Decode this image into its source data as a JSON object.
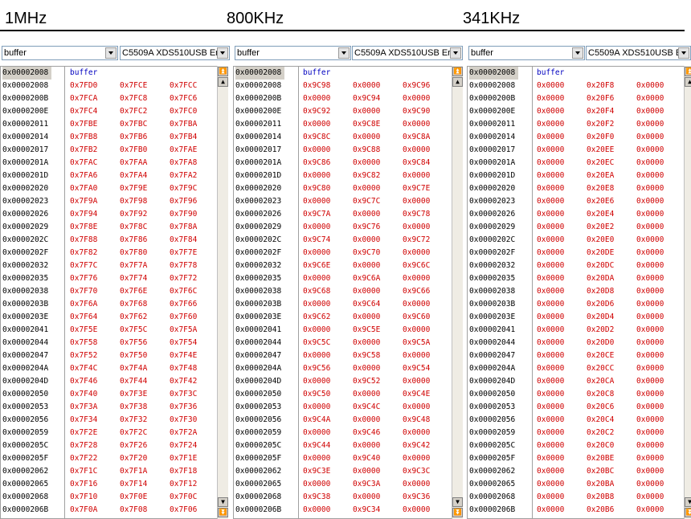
{
  "titles": [
    "1MHz",
    "800KHz",
    "341KHz"
  ],
  "panels": [
    {
      "combo_var": "buffer",
      "combo_target": "C5509A XDS510USB Er",
      "header_label": "buffer",
      "first_addr": "0x00002008",
      "rows": [
        {
          "addr": "0x00002008",
          "v": [
            "0x7FD0",
            "0x7FCE",
            "0x7FCC"
          ]
        },
        {
          "addr": "0x0000200B",
          "v": [
            "0x7FCA",
            "0x7FC8",
            "0x7FC6"
          ]
        },
        {
          "addr": "0x0000200E",
          "v": [
            "0x7FC4",
            "0x7FC2",
            "0x7FC0"
          ]
        },
        {
          "addr": "0x00002011",
          "v": [
            "0x7FBE",
            "0x7FBC",
            "0x7FBA"
          ]
        },
        {
          "addr": "0x00002014",
          "v": [
            "0x7FB8",
            "0x7FB6",
            "0x7FB4"
          ]
        },
        {
          "addr": "0x00002017",
          "v": [
            "0x7FB2",
            "0x7FB0",
            "0x7FAE"
          ]
        },
        {
          "addr": "0x0000201A",
          "v": [
            "0x7FAC",
            "0x7FAA",
            "0x7FA8"
          ]
        },
        {
          "addr": "0x0000201D",
          "v": [
            "0x7FA6",
            "0x7FA4",
            "0x7FA2"
          ]
        },
        {
          "addr": "0x00002020",
          "v": [
            "0x7FA0",
            "0x7F9E",
            "0x7F9C"
          ]
        },
        {
          "addr": "0x00002023",
          "v": [
            "0x7F9A",
            "0x7F98",
            "0x7F96"
          ]
        },
        {
          "addr": "0x00002026",
          "v": [
            "0x7F94",
            "0x7F92",
            "0x7F90"
          ]
        },
        {
          "addr": "0x00002029",
          "v": [
            "0x7F8E",
            "0x7F8C",
            "0x7F8A"
          ]
        },
        {
          "addr": "0x0000202C",
          "v": [
            "0x7F88",
            "0x7F86",
            "0x7F84"
          ]
        },
        {
          "addr": "0x0000202F",
          "v": [
            "0x7F82",
            "0x7F80",
            "0x7F7E"
          ]
        },
        {
          "addr": "0x00002032",
          "v": [
            "0x7F7C",
            "0x7F7A",
            "0x7F78"
          ]
        },
        {
          "addr": "0x00002035",
          "v": [
            "0x7F76",
            "0x7F74",
            "0x7F72"
          ]
        },
        {
          "addr": "0x00002038",
          "v": [
            "0x7F70",
            "0x7F6E",
            "0x7F6C"
          ]
        },
        {
          "addr": "0x0000203B",
          "v": [
            "0x7F6A",
            "0x7F68",
            "0x7F66"
          ]
        },
        {
          "addr": "0x0000203E",
          "v": [
            "0x7F64",
            "0x7F62",
            "0x7F60"
          ]
        },
        {
          "addr": "0x00002041",
          "v": [
            "0x7F5E",
            "0x7F5C",
            "0x7F5A"
          ]
        },
        {
          "addr": "0x00002044",
          "v": [
            "0x7F58",
            "0x7F56",
            "0x7F54"
          ]
        },
        {
          "addr": "0x00002047",
          "v": [
            "0x7F52",
            "0x7F50",
            "0x7F4E"
          ]
        },
        {
          "addr": "0x0000204A",
          "v": [
            "0x7F4C",
            "0x7F4A",
            "0x7F48"
          ]
        },
        {
          "addr": "0x0000204D",
          "v": [
            "0x7F46",
            "0x7F44",
            "0x7F42"
          ]
        },
        {
          "addr": "0x00002050",
          "v": [
            "0x7F40",
            "0x7F3E",
            "0x7F3C"
          ]
        },
        {
          "addr": "0x00002053",
          "v": [
            "0x7F3A",
            "0x7F38",
            "0x7F36"
          ]
        },
        {
          "addr": "0x00002056",
          "v": [
            "0x7F34",
            "0x7F32",
            "0x7F30"
          ]
        },
        {
          "addr": "0x00002059",
          "v": [
            "0x7F2E",
            "0x7F2C",
            "0x7F2A"
          ]
        },
        {
          "addr": "0x0000205C",
          "v": [
            "0x7F28",
            "0x7F26",
            "0x7F24"
          ]
        },
        {
          "addr": "0x0000205F",
          "v": [
            "0x7F22",
            "0x7F20",
            "0x7F1E"
          ]
        },
        {
          "addr": "0x00002062",
          "v": [
            "0x7F1C",
            "0x7F1A",
            "0x7F18"
          ]
        },
        {
          "addr": "0x00002065",
          "v": [
            "0x7F16",
            "0x7F14",
            "0x7F12"
          ]
        },
        {
          "addr": "0x00002068",
          "v": [
            "0x7F10",
            "0x7F0E",
            "0x7F0C"
          ]
        },
        {
          "addr": "0x0000206B",
          "v": [
            "0x7F0A",
            "0x7F08",
            "0x7F06"
          ]
        }
      ]
    },
    {
      "combo_var": "buffer",
      "combo_target": "C5509A XDS510USB Er",
      "header_label": "buffer",
      "first_addr": "0x00002008",
      "rows": [
        {
          "addr": "0x00002008",
          "v": [
            "0x9C98",
            "0x0000",
            "0x9C96"
          ]
        },
        {
          "addr": "0x0000200B",
          "v": [
            "0x0000",
            "0x9C94",
            "0x0000"
          ]
        },
        {
          "addr": "0x0000200E",
          "v": [
            "0x9C92",
            "0x0000",
            "0x9C90"
          ]
        },
        {
          "addr": "0x00002011",
          "v": [
            "0x0000",
            "0x9C8E",
            "0x0000"
          ]
        },
        {
          "addr": "0x00002014",
          "v": [
            "0x9C8C",
            "0x0000",
            "0x9C8A"
          ]
        },
        {
          "addr": "0x00002017",
          "v": [
            "0x0000",
            "0x9C88",
            "0x0000"
          ]
        },
        {
          "addr": "0x0000201A",
          "v": [
            "0x9C86",
            "0x0000",
            "0x9C84"
          ]
        },
        {
          "addr": "0x0000201D",
          "v": [
            "0x0000",
            "0x9C82",
            "0x0000"
          ]
        },
        {
          "addr": "0x00002020",
          "v": [
            "0x9C80",
            "0x0000",
            "0x9C7E"
          ]
        },
        {
          "addr": "0x00002023",
          "v": [
            "0x0000",
            "0x9C7C",
            "0x0000"
          ]
        },
        {
          "addr": "0x00002026",
          "v": [
            "0x9C7A",
            "0x0000",
            "0x9C78"
          ]
        },
        {
          "addr": "0x00002029",
          "v": [
            "0x0000",
            "0x9C76",
            "0x0000"
          ]
        },
        {
          "addr": "0x0000202C",
          "v": [
            "0x9C74",
            "0x0000",
            "0x9C72"
          ]
        },
        {
          "addr": "0x0000202F",
          "v": [
            "0x0000",
            "0x9C70",
            "0x0000"
          ]
        },
        {
          "addr": "0x00002032",
          "v": [
            "0x9C6E",
            "0x0000",
            "0x9C6C"
          ]
        },
        {
          "addr": "0x00002035",
          "v": [
            "0x0000",
            "0x9C6A",
            "0x0000"
          ]
        },
        {
          "addr": "0x00002038",
          "v": [
            "0x9C68",
            "0x0000",
            "0x9C66"
          ]
        },
        {
          "addr": "0x0000203B",
          "v": [
            "0x0000",
            "0x9C64",
            "0x0000"
          ]
        },
        {
          "addr": "0x0000203E",
          "v": [
            "0x9C62",
            "0x0000",
            "0x9C60"
          ]
        },
        {
          "addr": "0x00002041",
          "v": [
            "0x0000",
            "0x9C5E",
            "0x0000"
          ]
        },
        {
          "addr": "0x00002044",
          "v": [
            "0x9C5C",
            "0x0000",
            "0x9C5A"
          ]
        },
        {
          "addr": "0x00002047",
          "v": [
            "0x0000",
            "0x9C58",
            "0x0000"
          ]
        },
        {
          "addr": "0x0000204A",
          "v": [
            "0x9C56",
            "0x0000",
            "0x9C54"
          ]
        },
        {
          "addr": "0x0000204D",
          "v": [
            "0x0000",
            "0x9C52",
            "0x0000"
          ]
        },
        {
          "addr": "0x00002050",
          "v": [
            "0x9C50",
            "0x0000",
            "0x9C4E"
          ]
        },
        {
          "addr": "0x00002053",
          "v": [
            "0x0000",
            "0x9C4C",
            "0x0000"
          ]
        },
        {
          "addr": "0x00002056",
          "v": [
            "0x9C4A",
            "0x0000",
            "0x9C48"
          ]
        },
        {
          "addr": "0x00002059",
          "v": [
            "0x0000",
            "0x9C46",
            "0x0000"
          ]
        },
        {
          "addr": "0x0000205C",
          "v": [
            "0x9C44",
            "0x0000",
            "0x9C42"
          ]
        },
        {
          "addr": "0x0000205F",
          "v": [
            "0x0000",
            "0x9C40",
            "0x0000"
          ]
        },
        {
          "addr": "0x00002062",
          "v": [
            "0x9C3E",
            "0x0000",
            "0x9C3C"
          ]
        },
        {
          "addr": "0x00002065",
          "v": [
            "0x0000",
            "0x9C3A",
            "0x0000"
          ]
        },
        {
          "addr": "0x00002068",
          "v": [
            "0x9C38",
            "0x0000",
            "0x9C36"
          ]
        },
        {
          "addr": "0x0000206B",
          "v": [
            "0x0000",
            "0x9C34",
            "0x0000"
          ]
        }
      ]
    },
    {
      "combo_var": "buffer",
      "combo_target": "C5509A XDS510USB E",
      "header_label": "buffer",
      "first_addr": "0x00002008",
      "rows": [
        {
          "addr": "0x00002008",
          "v": [
            "0x0000",
            "0x20F8",
            "0x0000"
          ]
        },
        {
          "addr": "0x0000200B",
          "v": [
            "0x0000",
            "0x20F6",
            "0x0000"
          ]
        },
        {
          "addr": "0x0000200E",
          "v": [
            "0x0000",
            "0x20F4",
            "0x0000"
          ]
        },
        {
          "addr": "0x00002011",
          "v": [
            "0x0000",
            "0x20F2",
            "0x0000"
          ]
        },
        {
          "addr": "0x00002014",
          "v": [
            "0x0000",
            "0x20F0",
            "0x0000"
          ]
        },
        {
          "addr": "0x00002017",
          "v": [
            "0x0000",
            "0x20EE",
            "0x0000"
          ]
        },
        {
          "addr": "0x0000201A",
          "v": [
            "0x0000",
            "0x20EC",
            "0x0000"
          ]
        },
        {
          "addr": "0x0000201D",
          "v": [
            "0x0000",
            "0x20EA",
            "0x0000"
          ]
        },
        {
          "addr": "0x00002020",
          "v": [
            "0x0000",
            "0x20E8",
            "0x0000"
          ]
        },
        {
          "addr": "0x00002023",
          "v": [
            "0x0000",
            "0x20E6",
            "0x0000"
          ]
        },
        {
          "addr": "0x00002026",
          "v": [
            "0x0000",
            "0x20E4",
            "0x0000"
          ]
        },
        {
          "addr": "0x00002029",
          "v": [
            "0x0000",
            "0x20E2",
            "0x0000"
          ]
        },
        {
          "addr": "0x0000202C",
          "v": [
            "0x0000",
            "0x20E0",
            "0x0000"
          ]
        },
        {
          "addr": "0x0000202F",
          "v": [
            "0x0000",
            "0x20DE",
            "0x0000"
          ]
        },
        {
          "addr": "0x00002032",
          "v": [
            "0x0000",
            "0x20DC",
            "0x0000"
          ]
        },
        {
          "addr": "0x00002035",
          "v": [
            "0x0000",
            "0x20DA",
            "0x0000"
          ]
        },
        {
          "addr": "0x00002038",
          "v": [
            "0x0000",
            "0x20D8",
            "0x0000"
          ]
        },
        {
          "addr": "0x0000203B",
          "v": [
            "0x0000",
            "0x20D6",
            "0x0000"
          ]
        },
        {
          "addr": "0x0000203E",
          "v": [
            "0x0000",
            "0x20D4",
            "0x0000"
          ]
        },
        {
          "addr": "0x00002041",
          "v": [
            "0x0000",
            "0x20D2",
            "0x0000"
          ]
        },
        {
          "addr": "0x00002044",
          "v": [
            "0x0000",
            "0x20D0",
            "0x0000"
          ]
        },
        {
          "addr": "0x00002047",
          "v": [
            "0x0000",
            "0x20CE",
            "0x0000"
          ]
        },
        {
          "addr": "0x0000204A",
          "v": [
            "0x0000",
            "0x20CC",
            "0x0000"
          ]
        },
        {
          "addr": "0x0000204D",
          "v": [
            "0x0000",
            "0x20CA",
            "0x0000"
          ]
        },
        {
          "addr": "0x00002050",
          "v": [
            "0x0000",
            "0x20C8",
            "0x0000"
          ]
        },
        {
          "addr": "0x00002053",
          "v": [
            "0x0000",
            "0x20C6",
            "0x0000"
          ]
        },
        {
          "addr": "0x00002056",
          "v": [
            "0x0000",
            "0x20C4",
            "0x0000"
          ]
        },
        {
          "addr": "0x00002059",
          "v": [
            "0x0000",
            "0x20C2",
            "0x0000"
          ]
        },
        {
          "addr": "0x0000205C",
          "v": [
            "0x0000",
            "0x20C0",
            "0x0000"
          ]
        },
        {
          "addr": "0x0000205F",
          "v": [
            "0x0000",
            "0x20BE",
            "0x0000"
          ]
        },
        {
          "addr": "0x00002062",
          "v": [
            "0x0000",
            "0x20BC",
            "0x0000"
          ]
        },
        {
          "addr": "0x00002065",
          "v": [
            "0x0000",
            "0x20BA",
            "0x0000"
          ]
        },
        {
          "addr": "0x00002068",
          "v": [
            "0x0000",
            "0x20B8",
            "0x0000"
          ]
        },
        {
          "addr": "0x0000206B",
          "v": [
            "0x0000",
            "0x20B6",
            "0x0000"
          ]
        }
      ]
    }
  ],
  "colors": {
    "address": "#000000",
    "value": "#d00000",
    "label": "#0000c0",
    "addr_highlight": "#d4d0c8"
  },
  "icons": {
    "combo_arrow": "chevron-down-icon",
    "scroll_top": "scroll-top-icon",
    "scroll_up": "scroll-up-icon",
    "scroll_down": "scroll-down-icon",
    "scroll_bottom": "scroll-bottom-icon"
  }
}
